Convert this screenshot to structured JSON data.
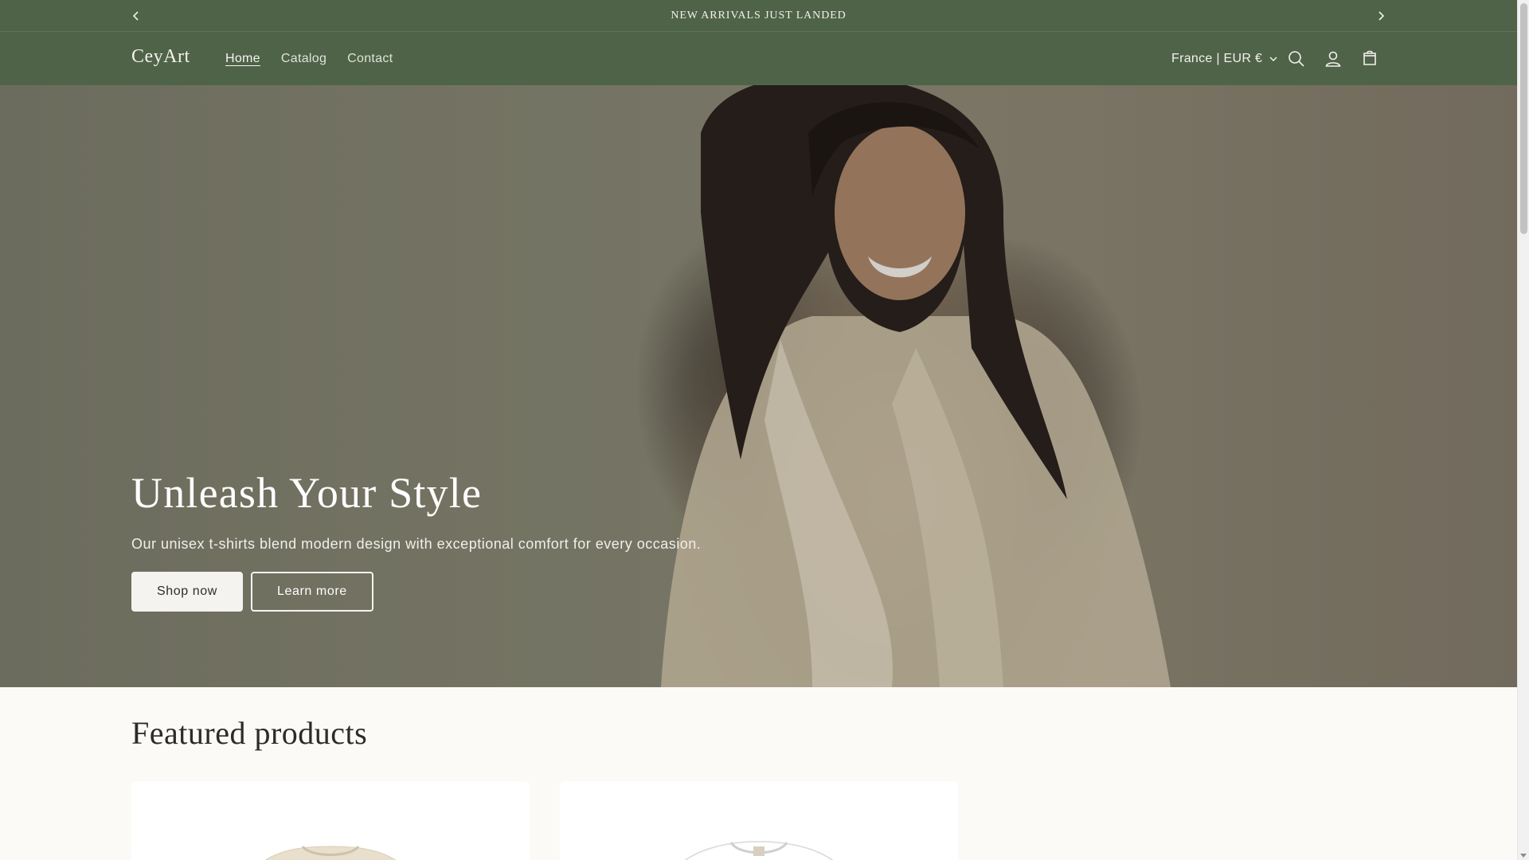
{
  "announcement": {
    "text": "NEW ARRIVALS JUST LANDED",
    "prev_icon": "chevron-left-icon",
    "next_icon": "chevron-right-icon"
  },
  "header": {
    "logo": "CeyArt",
    "nav": [
      {
        "label": "Home",
        "active": true
      },
      {
        "label": "Catalog",
        "active": false
      },
      {
        "label": "Contact",
        "active": false
      }
    ],
    "country_selector": "France | EUR €",
    "icons": [
      "search-icon",
      "account-icon",
      "cart-icon"
    ]
  },
  "hero": {
    "title": "Unleash Your Style",
    "subtitle": "Our unisex t-shirts blend modern design with exceptional comfort for every occasion.",
    "primary_button": "Shop now",
    "secondary_button": "Learn more"
  },
  "featured": {
    "title": "Featured products"
  },
  "colors": {
    "header_bg": "#4f6349",
    "page_bg": "#fbfaf6",
    "button_bg": "#f4f3ef"
  }
}
